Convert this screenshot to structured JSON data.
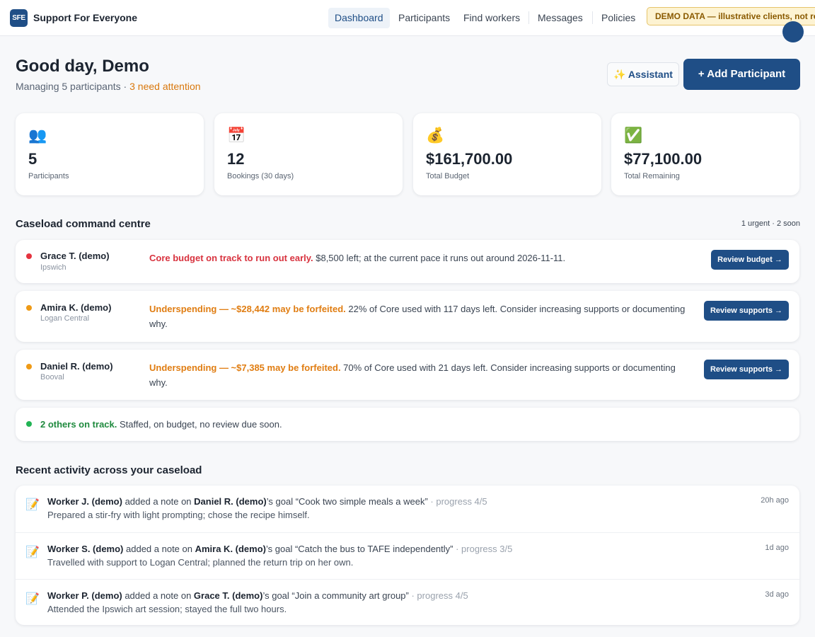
{
  "nav": {
    "logo_text": "SFE",
    "brand": "Support For Everyone",
    "items": [
      {
        "label": "Dashboard",
        "active": true
      },
      {
        "label": "Participants",
        "active": false
      },
      {
        "label": "Find workers",
        "active": false
      },
      {
        "label": "Messages",
        "active": false
      },
      {
        "label": "Policies",
        "active": false
      }
    ],
    "demo_banner": "DEMO DATA — illustrative clients, not real"
  },
  "header": {
    "greeting": "Good day, Demo",
    "managing": "Managing 5 participants",
    "separator": " · ",
    "attention": "3 need attention",
    "assistant_icon": "✨",
    "assistant_label": "Assistant",
    "add_label": "+ Add Participant"
  },
  "stats": [
    {
      "icon": "👥",
      "icon_name": "people-icon",
      "value": "5",
      "label": "Participants"
    },
    {
      "icon": "📅",
      "icon_name": "calendar-icon",
      "value": "12",
      "label": "Bookings (30 days)"
    },
    {
      "icon": "💰",
      "icon_name": "money-bag-icon",
      "value": "$161,700.00",
      "label": "Total Budget"
    },
    {
      "icon": "✅",
      "icon_name": "check-icon",
      "value": "$77,100.00",
      "label": "Total Remaining"
    }
  ],
  "caseload": {
    "title": "Caseload command centre",
    "summary": "1 urgent · 2 soon",
    "items": [
      {
        "name": "Grace T. (demo)",
        "location": "Ipswich",
        "status_color": "#e5333f",
        "highlight": "Core budget on track to run out early.",
        "highlight_color": "#d8333f",
        "detail": " $8,500 left; at the current pace it runs out around 2026-11-11.",
        "action": "Review budget →"
      },
      {
        "name": "Amira K. (demo)",
        "location": "Logan Central",
        "status_color": "#ef9a16",
        "highlight": "Underspending — ~$28,442 may be forfeited.",
        "highlight_color": "#e07d12",
        "detail": " 22% of Core used with 117 days left. Consider increasing supports or documenting why.",
        "action": "Review supports →"
      },
      {
        "name": "Daniel R. (demo)",
        "location": "Booval",
        "status_color": "#ef9a16",
        "highlight": "Underspending — ~$7,385 may be forfeited.",
        "highlight_color": "#e07d12",
        "detail": " 70% of Core used with 21 days left. Consider increasing supports or documenting why.",
        "action": "Review supports →"
      }
    ],
    "on_track": {
      "status_color": "#22b455",
      "highlight": "2 others on track.",
      "highlight_color": "#1f8a3e",
      "detail": " Staffed, on budget, no review due soon."
    }
  },
  "activity": {
    "title": "Recent activity across your caseload",
    "items": [
      {
        "icon": "📝",
        "worker": "Worker J. (demo)",
        "mid": " added a note on ",
        "participant": "Daniel R. (demo)",
        "goal_prefix": "’s goal “Cook two simple meals a week”",
        "progress": " · progress 4/5",
        "note": "Prepared a stir-fry with light prompting; chose the recipe himself.",
        "time": "20h ago"
      },
      {
        "icon": "📝",
        "worker": "Worker S. (demo)",
        "mid": " added a note on ",
        "participant": "Amira K. (demo)",
        "goal_prefix": "’s goal “Catch the bus to TAFE independently”",
        "progress": " · progress 3/5",
        "note": "Travelled with support to Logan Central; planned the return trip on her own.",
        "time": "1d ago"
      },
      {
        "icon": "📝",
        "worker": "Worker P. (demo)",
        "mid": " added a note on ",
        "participant": "Grace T. (demo)",
        "goal_prefix": "’s goal “Join a community art group”",
        "progress": " · progress 4/5",
        "note": "Attended the Ipswich art session; stayed the full two hours.",
        "time": "3d ago"
      }
    ]
  },
  "colors": {
    "brand": "#1f4e86",
    "warning": "#d9780d",
    "urgent": "#d8333f",
    "ok": "#1f8a3e"
  }
}
